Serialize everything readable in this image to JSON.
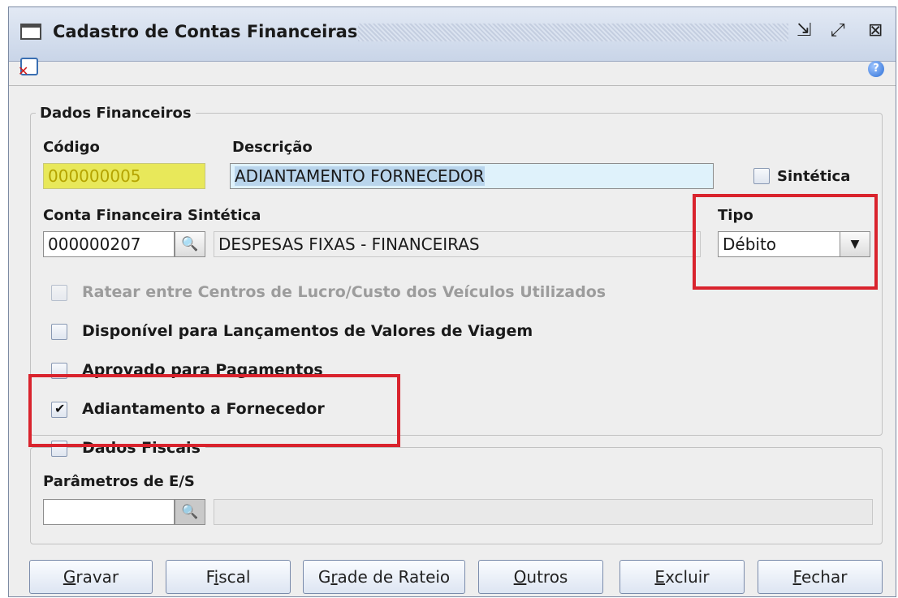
{
  "window": {
    "title": "Cadastro de Contas Financeiras",
    "controls": {
      "restore": "⇲",
      "maximize": "⤢",
      "close": "⊠"
    }
  },
  "toolbar": {
    "close_icon": "close-document-icon",
    "help_icon": "help-icon",
    "help_glyph": "?"
  },
  "dados_financeiros": {
    "legend": "Dados Financeiros",
    "codigo_label": "Código",
    "codigo_value": "000000005",
    "descricao_label": "Descrição",
    "descricao_value": "ADIANTAMENTO FORNECEDOR",
    "sintetica_label": "Sintética",
    "conta_label": "Conta Financeira Sintética",
    "conta_code": "000000207",
    "conta_desc": "DESPESAS FIXAS - FINANCEIRAS",
    "tipo_label": "Tipo",
    "tipo_value": "Débito",
    "checkboxes": [
      {
        "label": "Ratear entre Centros de Lucro/Custo dos Veículos Utilizados",
        "checked": false,
        "enabled": false
      },
      {
        "label": "Disponível para Lançamentos de Valores de Viagem",
        "checked": false,
        "enabled": true
      },
      {
        "label": "Aprovado para Pagamentos",
        "checked": false,
        "enabled": true
      },
      {
        "label": "Adiantamento a Fornecedor",
        "checked": true,
        "enabled": true
      }
    ]
  },
  "dados_fiscais": {
    "label": "Dados Fiscais",
    "checked": false,
    "parametros_label": "Parâmetros de E/S"
  },
  "buttons": [
    {
      "prefix": "",
      "key": "G",
      "rest": "ravar"
    },
    {
      "prefix": "F",
      "key": "i",
      "rest": "scal"
    },
    {
      "prefix": "G",
      "key": "r",
      "rest": "ade de Rateio"
    },
    {
      "prefix": "",
      "key": "O",
      "rest": "utros"
    },
    {
      "prefix": "",
      "key": "E",
      "rest": "xcluir"
    },
    {
      "prefix": "",
      "key": "F",
      "rest": "echar"
    }
  ],
  "colors": {
    "codigo_bg": "#e8e85a",
    "descricao_bg": "#dff2fb",
    "highlight_red": "#d9232d",
    "button_gradient_bottom": "#dde5f2"
  }
}
